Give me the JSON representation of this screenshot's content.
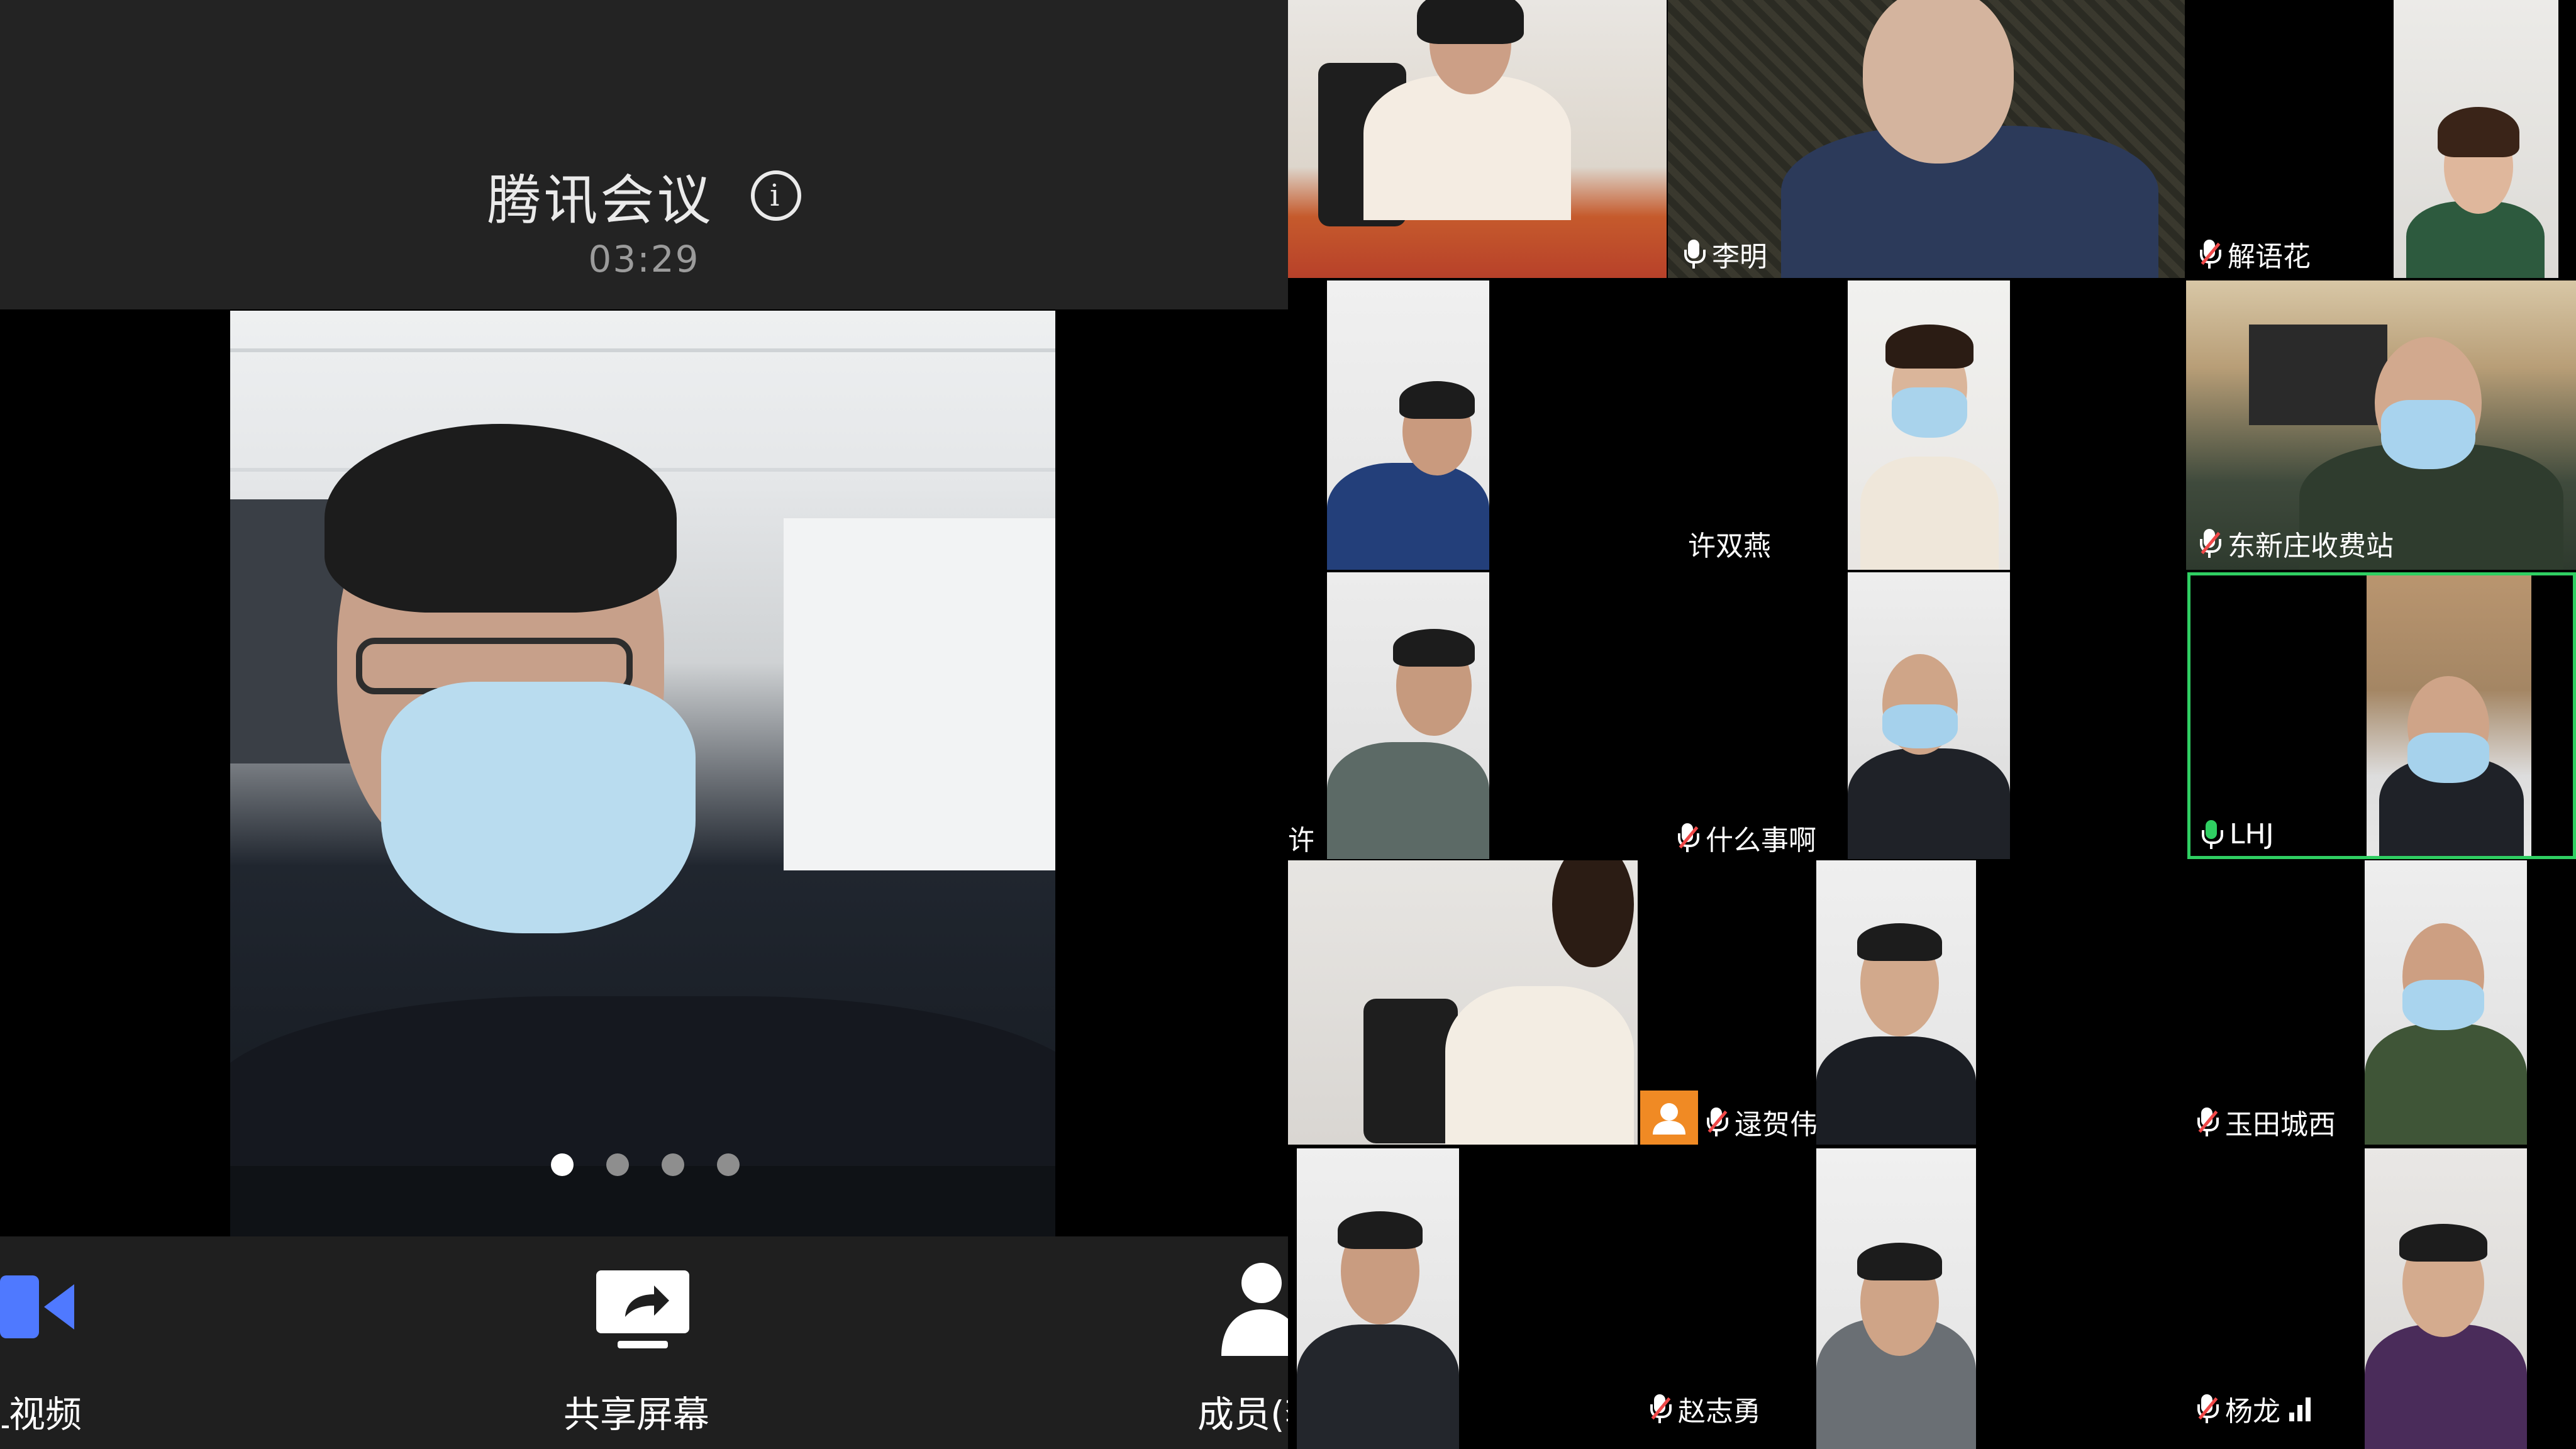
{
  "meeting": {
    "title": "腾讯会议",
    "timer": "03:29",
    "page_count": 4,
    "active_page": 1
  },
  "toolbar": {
    "video_label": "视频",
    "video_label_prefix": "上",
    "share_label": "共享屏幕",
    "members_label": "成员(李宏文)"
  },
  "participants": [
    {
      "name": "李明",
      "mic": "on"
    },
    {
      "name": "解语花",
      "mic": "muted"
    },
    {
      "name": "许双燕",
      "mic": "none"
    },
    {
      "name": "东新庄收费站",
      "mic": "muted"
    },
    {
      "name": "许",
      "mic": "none"
    },
    {
      "name": "什么事啊",
      "mic": "muted"
    },
    {
      "name": "LHJ",
      "mic": "active"
    },
    {
      "name": "逯贺伟",
      "mic": "muted"
    },
    {
      "name": "玉田城西",
      "mic": "muted"
    },
    {
      "name": "赵志勇",
      "mic": "muted"
    },
    {
      "name": "杨龙",
      "mic": "muted"
    }
  ],
  "colors": {
    "topbar_bg": "#232323",
    "bottombar_bg": "#1f1f1f",
    "video_icon": "#4f79ff",
    "speaking_highlight": "#2fcf62",
    "muted_slash": "#f04848",
    "avatar_badge": "#f08a24"
  }
}
